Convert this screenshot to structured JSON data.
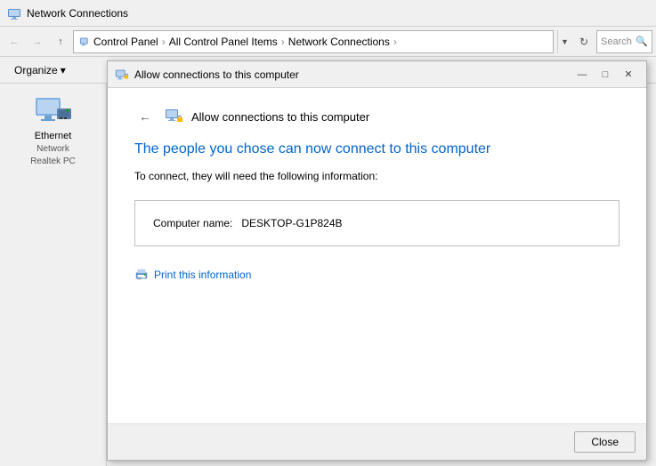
{
  "window": {
    "title": "Network Connections",
    "icon": "network"
  },
  "address_bar": {
    "back_tooltip": "Back",
    "forward_tooltip": "Forward",
    "up_tooltip": "Up",
    "breadcrumbs": [
      "Control Panel",
      "All Control Panel Items",
      "Network Connections"
    ],
    "refresh_tooltip": "Refresh",
    "search_placeholder": "Search Ne"
  },
  "toolbar": {
    "organize_label": "Organize",
    "organize_arrow": "▾"
  },
  "left_panel": {
    "ethernet_label": "Ethernet",
    "ethernet_sub1": "Network",
    "ethernet_sub2": "Realtek PC"
  },
  "dialog": {
    "title": "Allow connections to this computer",
    "success_text": "The people you chose can now connect to this computer",
    "info_intro": "To connect, they will need the following information:",
    "computer_name_label": "Computer name:",
    "computer_name_value": "DESKTOP-G1P824B",
    "print_label": "Print this information",
    "close_button": "Close",
    "back_arrow": "←",
    "minimize": "—",
    "restore": "□",
    "close_x": "✕"
  }
}
